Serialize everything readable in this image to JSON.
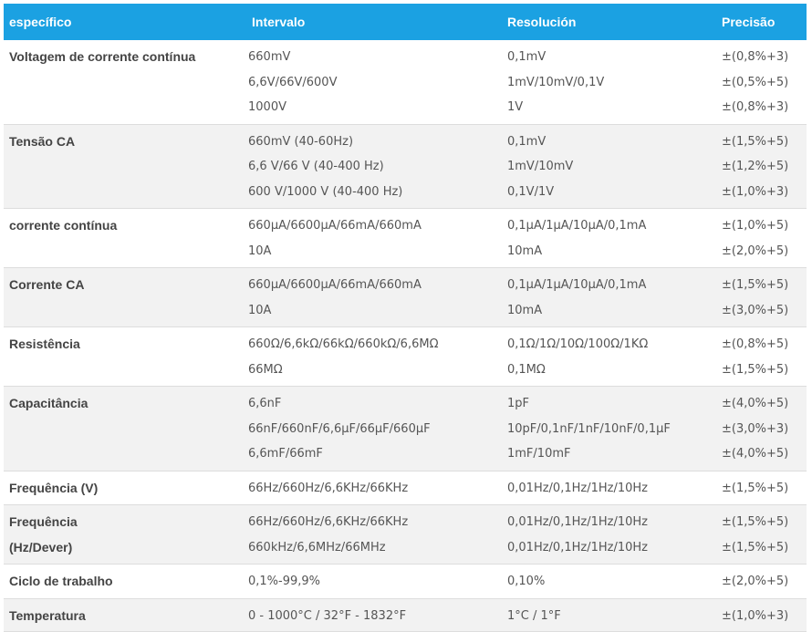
{
  "header": {
    "col1": "específico",
    "col2": "Intervalo",
    "col3": "Resolución",
    "col4": "Precisão"
  },
  "rows": [
    {
      "spec": [
        "Voltagem de corrente contínua"
      ],
      "range": [
        "660mV",
        "6,6V/66V/600V",
        "1000V"
      ],
      "resolution": [
        "0,1mV",
        "1mV/10mV/0,1V",
        "1V"
      ],
      "precision": [
        "±(0,8%+3)",
        "±(0,5%+5)",
        "±(0,8%+3)"
      ]
    },
    {
      "spec": [
        "Tensão CA"
      ],
      "range": [
        "660mV (40-60Hz)",
        "6,6 V/66 V (40-400 Hz)",
        "600 V/1000 V (40-400 Hz)"
      ],
      "resolution": [
        "0,1mV",
        "1mV/10mV",
        "0,1V/1V"
      ],
      "precision": [
        "±(1,5%+5)",
        "±(1,2%+5)",
        "±(1,0%+3)"
      ]
    },
    {
      "spec": [
        "corrente contínua"
      ],
      "range": [
        "660μA/6600μA/66mA/660mA",
        "10A"
      ],
      "resolution": [
        "0,1μA/1μA/10μA/0,1mA",
        "10mA"
      ],
      "precision": [
        "±(1,0%+5)",
        "±(2,0%+5)"
      ]
    },
    {
      "spec": [
        "Corrente CA"
      ],
      "range": [
        "660μA/6600μA/66mA/660mA",
        "10A"
      ],
      "resolution": [
        "0,1μA/1μA/10μA/0,1mA",
        "10mA"
      ],
      "precision": [
        "±(1,5%+5)",
        "±(3,0%+5)"
      ]
    },
    {
      "spec": [
        "Resistência"
      ],
      "range": [
        "660Ω/6,6kΩ/66kΩ/660kΩ/6,6MΩ",
        "66MΩ"
      ],
      "resolution": [
        "0,1Ω/1Ω/10Ω/100Ω/1KΩ",
        "0,1MΩ"
      ],
      "precision": [
        "±(0,8%+5)",
        "±(1,5%+5)"
      ]
    },
    {
      "spec": [
        "Capacitância"
      ],
      "range": [
        "6,6nF",
        "66nF/660nF/6,6μF/66μF/660μF",
        "6,6mF/66mF"
      ],
      "resolution": [
        "1pF",
        "10pF/0,1nF/1nF/10nF/0,1μF",
        "1mF/10mF"
      ],
      "precision": [
        "±(4,0%+5)",
        "±(3,0%+3)",
        "±(4,0%+5)"
      ]
    },
    {
      "spec": [
        "Frequência (V)"
      ],
      "range": [
        "66Hz/660Hz/6,6KHz/66KHz"
      ],
      "resolution": [
        "0,01Hz/0,1Hz/1Hz/10Hz"
      ],
      "precision": [
        "±(1,5%+5)"
      ]
    },
    {
      "spec": [
        "Frequência",
        "(Hz/Dever)"
      ],
      "range": [
        "66Hz/660Hz/6,6KHz/66KHz",
        "660kHz/6,6MHz/66MHz"
      ],
      "resolution": [
        "0,01Hz/0,1Hz/1Hz/10Hz",
        "0,01Hz/0,1Hz/1Hz/10Hz"
      ],
      "precision": [
        "±(1,5%+5)",
        "±(1,5%+5)"
      ]
    },
    {
      "spec": [
        "Ciclo de trabalho"
      ],
      "range": [
        "0,1%-99,9%"
      ],
      "resolution": [
        "0,10%"
      ],
      "precision": [
        "±(2,0%+5)"
      ]
    },
    {
      "spec": [
        "Temperatura"
      ],
      "range": [
        " 0 - 1000°C / 32°F - 1832°F"
      ],
      "resolution": [
        " 1°C / 1°F"
      ],
      "precision": [
        " ±(1,0%+3)"
      ]
    }
  ]
}
